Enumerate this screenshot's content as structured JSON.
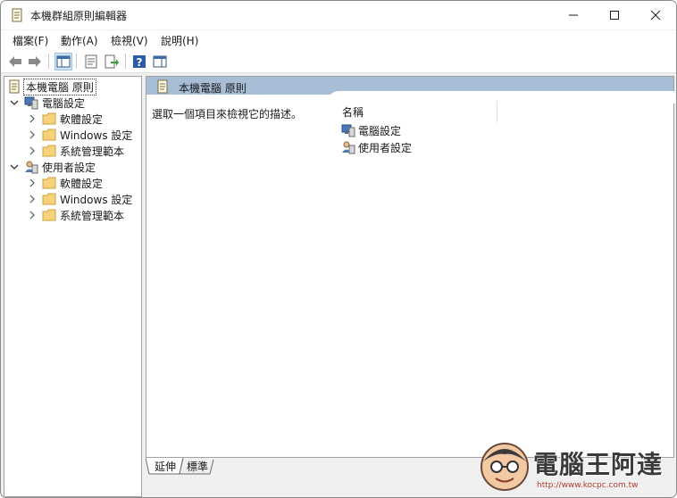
{
  "window": {
    "title": "本機群組原則編輯器"
  },
  "menu": [
    {
      "label": "檔案(F)"
    },
    {
      "label": "動作(A)"
    },
    {
      "label": "檢視(V)"
    },
    {
      "label": "說明(H)"
    }
  ],
  "toolbar": {
    "buttons": [
      "back-icon",
      "forward-icon",
      "show-hide-tree-icon",
      "properties-icon",
      "export-list-icon",
      "help-icon",
      "show-hide-action-pane-icon"
    ]
  },
  "tree": {
    "root": "本機電腦 原則",
    "computer": {
      "label": "電腦設定",
      "children": [
        "軟體設定",
        "Windows 設定",
        "系統管理範本"
      ]
    },
    "user": {
      "label": "使用者設定",
      "children": [
        "軟體設定",
        "Windows 設定",
        "系統管理範本"
      ]
    }
  },
  "content": {
    "header": "本機電腦 原則",
    "description": "選取一個項目來檢視它的描述。",
    "column_name": "名稱",
    "items": [
      "電腦設定",
      "使用者設定"
    ]
  },
  "tabs": [
    {
      "label": "延伸"
    },
    {
      "label": "標準"
    }
  ],
  "watermark": {
    "title": "電腦王阿達",
    "url": "http://www.kocpc.com.tw"
  },
  "colors": {
    "header_band": "#a8bed6",
    "accent": "#0067c0"
  }
}
